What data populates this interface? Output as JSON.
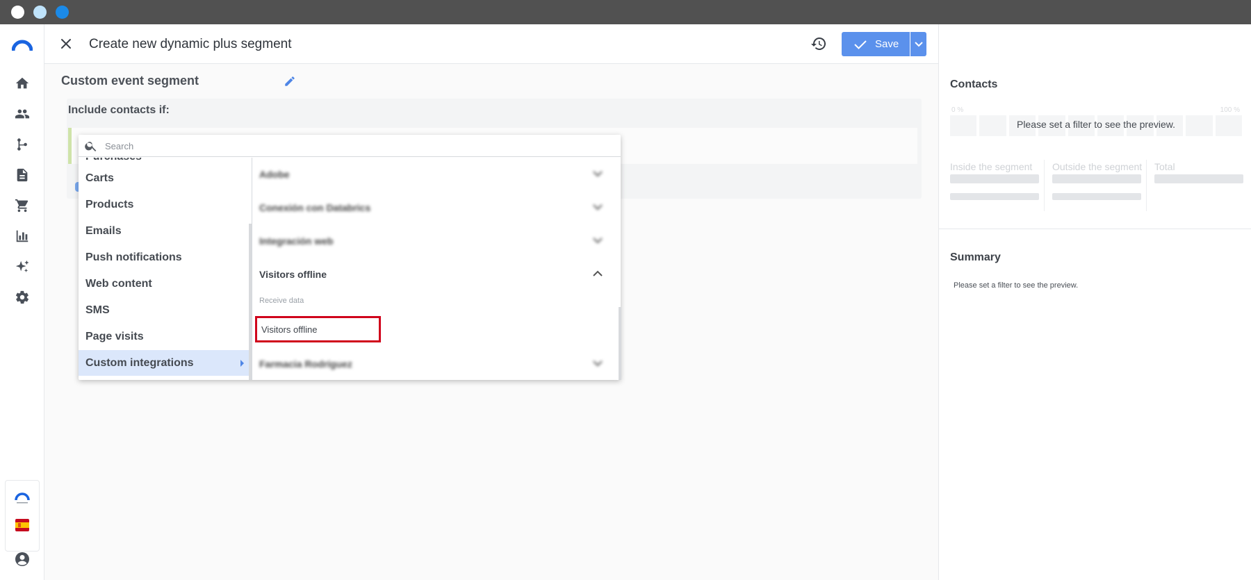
{
  "header": {
    "title": "Create new dynamic plus segment",
    "save_label": "Save"
  },
  "segment": {
    "name": "Custom event segment",
    "include_label": "Include contacts if:"
  },
  "dropdown": {
    "search_placeholder": "Search",
    "partial_category": "Purchases",
    "categories": [
      {
        "label": "Carts"
      },
      {
        "label": "Products"
      },
      {
        "label": "Emails"
      },
      {
        "label": "Push notifications"
      },
      {
        "label": "Web content"
      },
      {
        "label": "SMS"
      },
      {
        "label": "Page visits"
      },
      {
        "label": "Custom integrations",
        "selected": true
      }
    ],
    "integrations": [
      {
        "label": "Adobe",
        "blurred": true,
        "expanded": false
      },
      {
        "label": "Conexión con Databrics",
        "blurred": true,
        "expanded": false
      },
      {
        "label": "Integración web",
        "blurred": true,
        "expanded": false
      },
      {
        "label": "Visitors offline",
        "blurred": false,
        "expanded": true
      },
      {
        "label": "Farmacia Rodríguez",
        "blurred": true,
        "expanded": false
      }
    ],
    "sub_label": "Receive data",
    "highlighted_option": "Visitors offline"
  },
  "preview": {
    "contacts_heading": "Contacts",
    "pct_min": "0 %",
    "pct_max": "100 %",
    "empty_message": "Please set a filter to see the preview.",
    "inside_label": "Inside the segment",
    "outside_label": "Outside the segment",
    "total_label": "Total",
    "summary_heading": "Summary",
    "summary_message": "Please set a filter to see the preview."
  },
  "colors": {
    "accent": "#5b91ec",
    "highlight_border": "#d0021b",
    "selected_bg": "#dbe7fb"
  }
}
